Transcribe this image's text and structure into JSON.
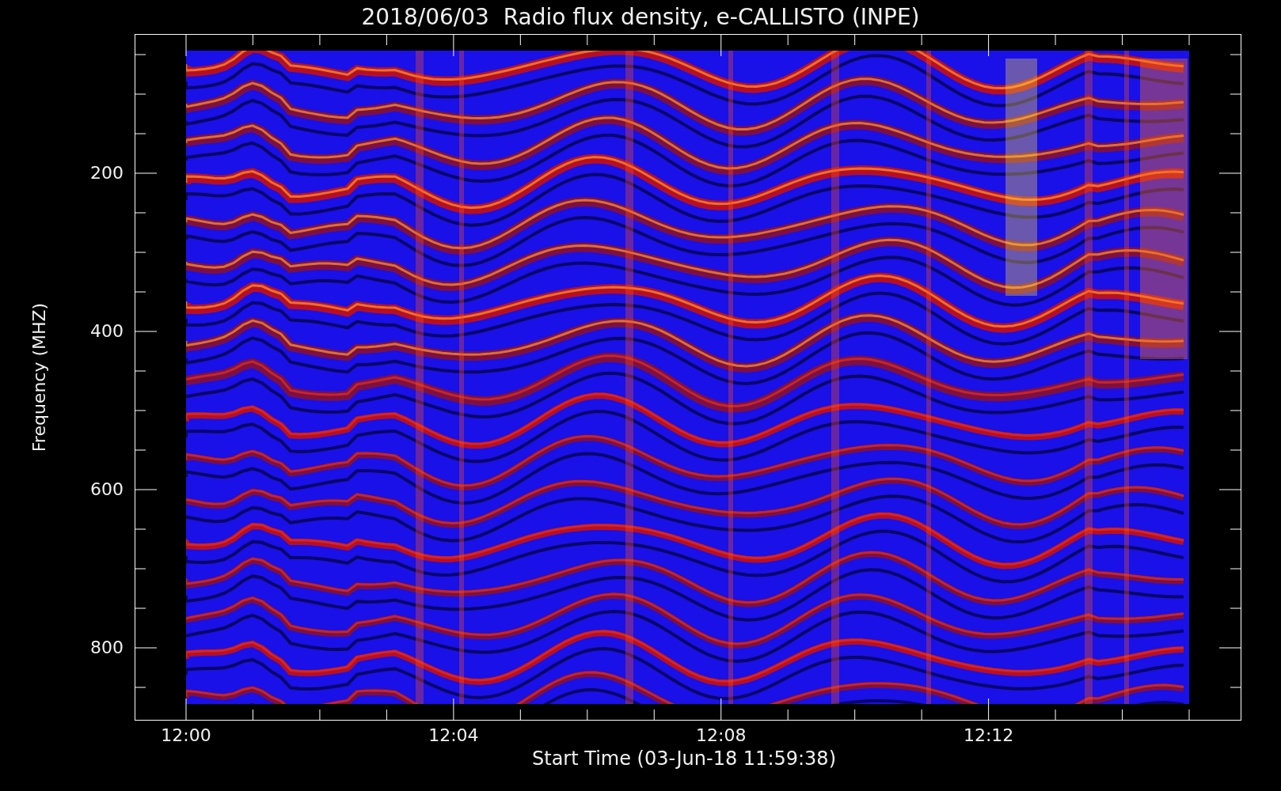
{
  "title": "2018/06/03  Radio flux density, e-CALLISTO (INPE)",
  "y_axis": {
    "label": "Frequency (MHZ)",
    "ticks": [
      "200",
      "400",
      "600",
      "800"
    ]
  },
  "x_axis": {
    "label": "Start Time (03-Jun-18 11:59:38)",
    "ticks": [
      "12:00",
      "12:04",
      "12:08",
      "12:12"
    ]
  }
}
